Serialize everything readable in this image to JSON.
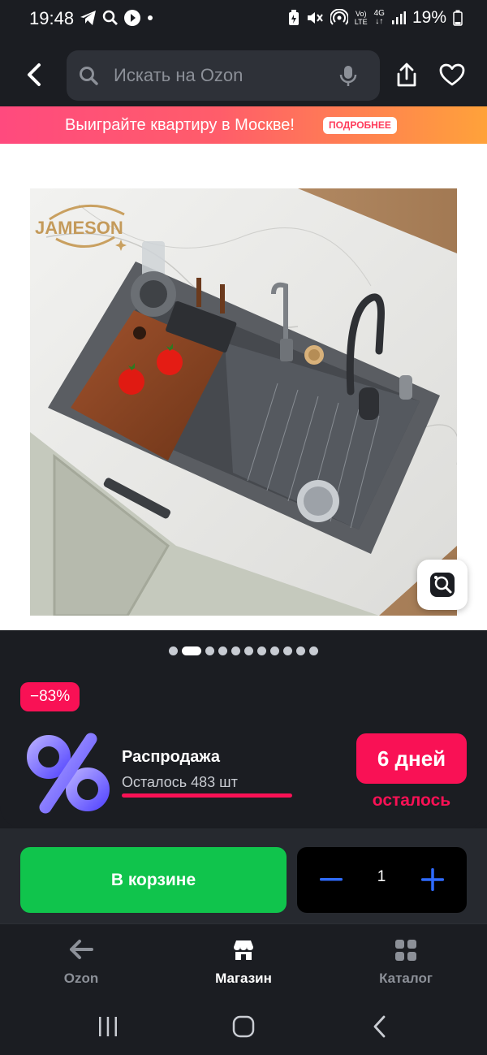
{
  "status_bar": {
    "time": "19:48",
    "battery": "19%",
    "network_vo": "Vo)",
    "network_lte": "LTE",
    "network_gen": "4G"
  },
  "search": {
    "placeholder": "Искать на Ozon"
  },
  "promo": {
    "text": "Выиграйте квартиру в Москве!",
    "badge": "ПОДРОБНЕЕ"
  },
  "product_image": {
    "brand_logo": "JAMESON",
    "active_index": 1,
    "total": 11
  },
  "sale": {
    "discount": "−83%",
    "title": "Распродажа",
    "remaining": "Осталось 483 шт",
    "remaining_fraction": 1.0,
    "days_badge": "6 дней",
    "days_label": "осталось"
  },
  "cart": {
    "button_label": "В корзине",
    "quantity": "1"
  },
  "bottom_nav": {
    "items": [
      {
        "label": "Ozon",
        "icon": "arrow-left-icon",
        "active": false
      },
      {
        "label": "Магазин",
        "icon": "store-icon",
        "active": true
      },
      {
        "label": "Каталог",
        "icon": "grid-icon",
        "active": false
      }
    ]
  },
  "colors": {
    "accent_pink": "#f91155",
    "cart_green": "#10c44c",
    "stepper_blue": "#2f6bff",
    "background": "#1b1d22"
  }
}
